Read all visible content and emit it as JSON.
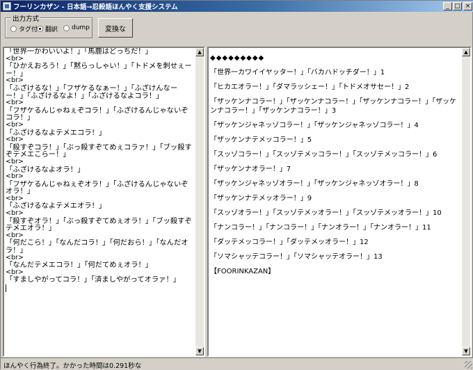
{
  "window": {
    "title": "フーリンカザン - 日本語→忍殺語ほんやく支援システム",
    "min_icon": "minimize-icon",
    "max_icon": "maximize-icon",
    "close_icon": "close-icon"
  },
  "output_mode": {
    "label": "出力方式",
    "options": [
      {
        "label": "タグ付",
        "selected": false
      },
      {
        "label": "翻訳",
        "selected": true
      },
      {
        "label": "dump",
        "selected": false
      }
    ]
  },
  "convert_button": "変換な",
  "left_text": [
    {
      "text": "「世界一かわいいよ！」「馬鹿はどっちだ！」",
      "tag": false
    },
    {
      "text": "<br>",
      "tag": true
    },
    {
      "text": "「ひかえおろう！」「黙らっしゃい！」「トドメを刺せぇーー！」",
      "tag": false
    },
    {
      "text": "<br>",
      "tag": true
    },
    {
      "text": "「ふざけるな！」「フザケるなぁー！」「ふざけんなーー！」「ふざけるなよ！」「ふざけるなよコラ！」",
      "tag": false
    },
    {
      "text": "<br>",
      "tag": true
    },
    {
      "text": "「フザケるんじゃねぇぞコラ！」「ふざけるんじゃないぞコラ！」",
      "tag": false
    },
    {
      "text": "<br>",
      "tag": true
    },
    {
      "text": "「ふざけるなよテメエコラ！」",
      "tag": false
    },
    {
      "text": "<br>",
      "tag": true
    },
    {
      "text": "「殺すぞコラ！」「ぶっ殺すぞてめぇコラァ！」「ブッ殺すぞテメエこらー！」",
      "tag": false
    },
    {
      "text": "<br>",
      "tag": true
    },
    {
      "text": "「ふざけるなよオラ！」",
      "tag": false
    },
    {
      "text": "<br>",
      "tag": true
    },
    {
      "text": "「フザケるんじゃねぇぞオラ！」「ふざけるんじゃないぞオラ！」",
      "tag": false
    },
    {
      "text": "<br>",
      "tag": true
    },
    {
      "text": "「ふざけるなよテメエオラ！」",
      "tag": false
    },
    {
      "text": "<br>",
      "tag": true
    },
    {
      "text": "「殺すぞオラ！」「ぶっ殺すぞてめぇオラ！」「ブッ殺すぞテメエオラ！」",
      "tag": false
    },
    {
      "text": "<br>",
      "tag": true
    },
    {
      "text": "「何だこら！」「なんだコラ！」「何だおら！」「なんだオラ！」",
      "tag": false
    },
    {
      "text": "<br>",
      "tag": true
    },
    {
      "text": "「なんだテメエコラ！」「何だてめぇオラ！」",
      "tag": false
    },
    {
      "text": "<br>",
      "tag": true
    },
    {
      "text": "「すましやがってコラ！」「済ましやがってオラァ！」",
      "tag": false
    }
  ],
  "right_header": "◆◆◆◆◆◆◆◆◆",
  "right_text": [
    "「世界一カワイイヤッター！」「バカハドッチダー！」1",
    "「ヒカエオラー！」「ダマラッシェー！」「トドメオサセー！」2",
    "「ザッケンナコラー！」「ザッケンナコラー！」「ザッケンナコラー！」「ザッケンナコラー！」「ザッケンナコラー！」3",
    "「ザッケンジャネッゾコラー！」「ザッケンジャネッゾコラー！」4",
    "「ザッケンナテメッコラー！」5",
    "「スッゾコラー！」「スッゾテメッコラー！」「スッゾテメッコラー！」6",
    "「ザッケンナオラー！」7",
    "「ザッケンジャネッゾオラー！」「ザッケンジャネッゾオラー！」8",
    "「ザッケンナテメッオラー！」9",
    "「スッゾオラー！」「スッゾテメッオラー！」「スッゾテメッオラー！」10",
    "「ナンコラー！」「ナンコラー！」「ナンオラー！」「ナンオラー！」11",
    "「ダッテメッコラー！」「ダッテメッオラー！」12",
    "「ソマシャッテコラー！」「ソマシャッテオラー！」13",
    "【FOORINKAZAN】"
  ],
  "status": "ほんやく行為終了。かかった時間は0.291秒な",
  "icons": {
    "scroll_up": "scroll-up-arrow-icon",
    "scroll_down": "scroll-down-arrow-icon",
    "grip": "size-grip-icon"
  }
}
